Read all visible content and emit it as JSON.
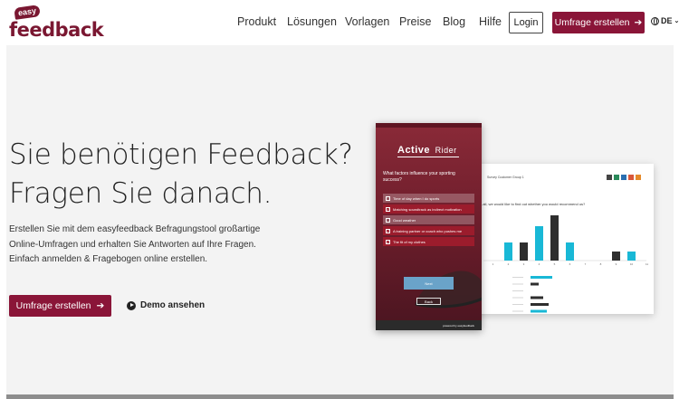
{
  "header": {
    "logo_small": "easy",
    "logo_main": "feedback",
    "nav": [
      {
        "label": "Produkt"
      },
      {
        "label": "Lösungen"
      },
      {
        "label": "Vorlagen"
      },
      {
        "label": "Preise"
      },
      {
        "label": "Blog"
      },
      {
        "label": "Hilfe"
      }
    ],
    "login_label": "Login",
    "cta_label": "Umfrage erstellen",
    "lang_label": "DE"
  },
  "hero": {
    "headline_line1": "Sie benötigen Feedback?",
    "headline_line2": "Fragen Sie danach.",
    "subtitle": "Erstellen Sie mit dem easyfeedback Befragungstool großartige Online-Umfragen und erhalten Sie Antworten auf Ihre Fragen. Einfach anmelden & Fragebogen online erstellen.",
    "cta_label": "Umfrage erstellen",
    "demo_label": "Demo ansehen"
  },
  "phone": {
    "brand_a": "Active",
    "brand_b": "Rider",
    "question": "What factors influence your sporting success?",
    "options": [
      {
        "label": "Time of day when I do sports",
        "selected": false
      },
      {
        "label": "Matching soundtrack as indirect motivation",
        "selected": true
      },
      {
        "label": "Good weather",
        "selected": false
      },
      {
        "label": "A training partner or coach who pushes me",
        "selected": true
      },
      {
        "label": "The fit of my clothes",
        "selected": true
      }
    ],
    "next_label": "Next",
    "back_label": "Back",
    "footer": "powered by easyfeedback"
  },
  "report": {
    "title": "Survey Customer Group 1",
    "question": "...all, we would like to find out whether you would recommend us?",
    "colors": {
      "accent": "#8a1538",
      "bar_dark": "#2e2e2e",
      "bar_cyan": "#19b8d6"
    }
  },
  "chart_data": {
    "type": "bar",
    "categories": [
      "1",
      "2",
      "3",
      "4",
      "5",
      "6",
      "7",
      "8",
      "9",
      "10",
      "11"
    ],
    "series": [
      {
        "values": [
          0,
          20,
          20,
          38,
          50,
          20,
          0,
          0,
          10,
          10,
          0
        ]
      }
    ]
  }
}
